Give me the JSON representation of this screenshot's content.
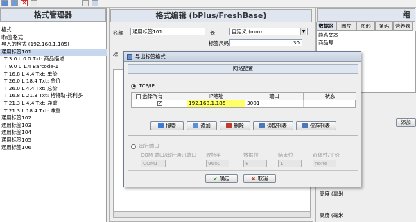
{
  "left_panel": {
    "title": "格式管理器",
    "tree": [
      "格式",
      "l标签格式",
      "导入的格式 (192.168.1.185)",
      "通用标签101",
      "T 3.0  L 0.0  Txt: 商品描述",
      "T 9.0  L 1.4  Barcode-1",
      "T 16.8  L 4.4  Txt: 单价",
      "T 26.0  L 18.4  Txt: 总价",
      "T 26.0  L 4.4  Txt: 总价",
      "T 16.8  L 21.3  Txt: 格特勒-托利多",
      "T 21.3  L 4.4  Txt: 净重",
      "T 21.3  L 18.4  Txt: 净重",
      "通用标签102",
      "通用标签103",
      "通用标签104",
      "通用标签105",
      "通用标签106"
    ]
  },
  "mid_panel": {
    "title": "格式编辑 (bPlus/FreshBase)",
    "name_label": "名称",
    "name_value": "通用标签101",
    "length_label": "长",
    "length_value": "自定义 (mm)",
    "size_label": "标签尺码",
    "size_value": "30",
    "std_label": "标"
  },
  "right_panel": {
    "title": "组",
    "tabs": [
      "数据区",
      "图片",
      "图形",
      "条码",
      "营养表"
    ],
    "items": [
      "静态文本",
      "商品号"
    ],
    "add_button": "添加",
    "height_label_1": "高度 (毫米",
    "height_label_2": "高度 (毫米"
  },
  "dialog": {
    "title": "导出标签格式",
    "section_title": "网络配置",
    "tcp_label": "TCP/IP",
    "columns": [
      "选择所有",
      "IP地址",
      "端口",
      "状态"
    ],
    "row": {
      "ip": "192.168.1.185",
      "port": "3001",
      "status": ""
    },
    "buttons": {
      "search": "搜索",
      "add": "添加",
      "delete": "删除",
      "read_list": "读取列表",
      "save_list": "保存列表"
    },
    "serial_label": "串行端口",
    "serial_fields": [
      {
        "label": "COM 端口/串行通讯端口",
        "value": "COM1"
      },
      {
        "label": "波特率",
        "value": "9600"
      },
      {
        "label": "数据位",
        "value": "8"
      },
      {
        "label": "结束位",
        "value": "1"
      },
      {
        "label": "奇偶性/平价",
        "value": "none"
      }
    ],
    "ok_button": "确定",
    "cancel_button": "取消"
  },
  "colors": {
    "accent": "#dfe6f0",
    "highlight": "#ffff66",
    "selection": "#c7d8ee"
  }
}
